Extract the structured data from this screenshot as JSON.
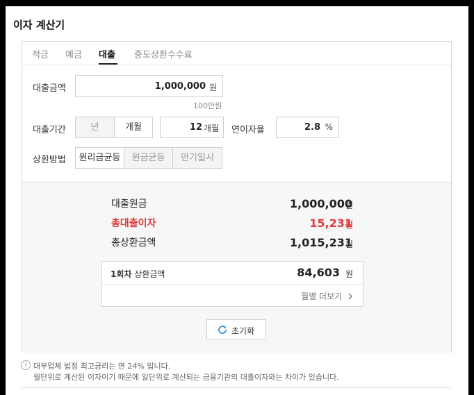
{
  "title": "이자 계산기",
  "tabs": [
    {
      "label": "적금",
      "active": false
    },
    {
      "label": "예금",
      "active": false
    },
    {
      "label": "대출",
      "active": true
    },
    {
      "label": "중도상환수수료",
      "active": false
    }
  ],
  "form": {
    "amount_label": "대출금액",
    "amount_value": "1,000,000",
    "amount_unit": "원",
    "amount_hint": "100만원",
    "period_label": "대출기간",
    "period_year": "년",
    "period_month": "개월",
    "months_value": "12",
    "months_unit": "개월",
    "rate_label": "연이자율",
    "rate_value": "2.8",
    "rate_unit": "%",
    "repay_label": "상환방법",
    "repay_options": [
      "원리금균등",
      "원금균등",
      "만기일시"
    ],
    "repay_selected": "원리금균등"
  },
  "results": {
    "principal_label": "대출원금",
    "principal_value": "1,000,000",
    "interest_label": "총대출이자",
    "interest_value": "15,231",
    "total_label": "총상환금액",
    "total_value": "1,015,231",
    "unit": "원",
    "installment_label_bold": "1회차",
    "installment_label": "상환금액",
    "installment_value": "84,603",
    "monthly_link": "월별 더보기",
    "reset_label": "초기화",
    "accent_red": "#e03a3a"
  },
  "notes": {
    "line1": "대부업체 법정 최고금리는 연 24% 입니다.",
    "line2": "월단위로 계산된 이자이기 때문에 일단위로 계산되는 금융기관의 대출이자와는 차이가 있습니다."
  }
}
